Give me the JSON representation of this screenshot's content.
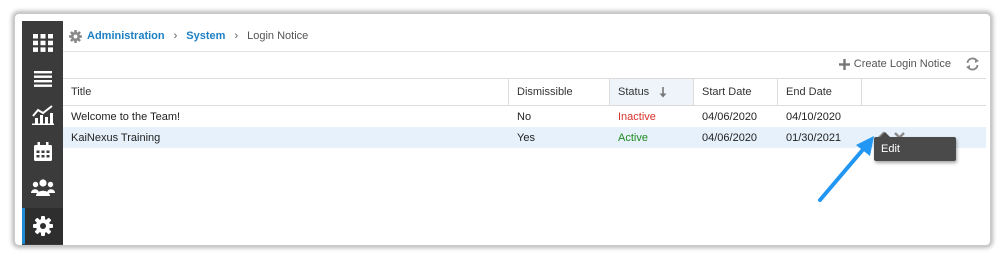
{
  "breadcrumb": {
    "icon": "gear-icon",
    "items": [
      "Administration",
      "System"
    ],
    "current": "Login Notice"
  },
  "toolbar": {
    "create_label": "Create Login Notice",
    "create_icon": "plus-icon",
    "refresh_icon": "refresh-icon"
  },
  "sidebar": {
    "items": [
      {
        "icon": "grid-icon",
        "active": false
      },
      {
        "icon": "list-icon",
        "active": false
      },
      {
        "icon": "chart-icon",
        "active": false
      },
      {
        "icon": "calendar-icon",
        "active": false
      },
      {
        "icon": "users-icon",
        "active": false
      },
      {
        "icon": "gear-icon",
        "active": true
      }
    ]
  },
  "table": {
    "columns": [
      "Title",
      "Dismissible",
      "Status",
      "Start Date",
      "End Date"
    ],
    "sorted_column": "Status",
    "rows": [
      {
        "title": "Welcome to the Team!",
        "dismissible": "No",
        "status": "Inactive",
        "start": "04/06/2020",
        "end": "04/10/2020"
      },
      {
        "title": "KaiNexus Training",
        "dismissible": "Yes",
        "status": "Active",
        "start": "04/06/2020",
        "end": "01/30/2021"
      }
    ]
  },
  "tooltip": {
    "label": "Edit"
  },
  "colors": {
    "accent": "#1b7fc4",
    "inactive": "#d8322a",
    "active": "#1f8a1f",
    "sidebar": "#3b3b3b",
    "selected_row": "#e6f1fb",
    "annotation_arrow": "#2196f3"
  }
}
